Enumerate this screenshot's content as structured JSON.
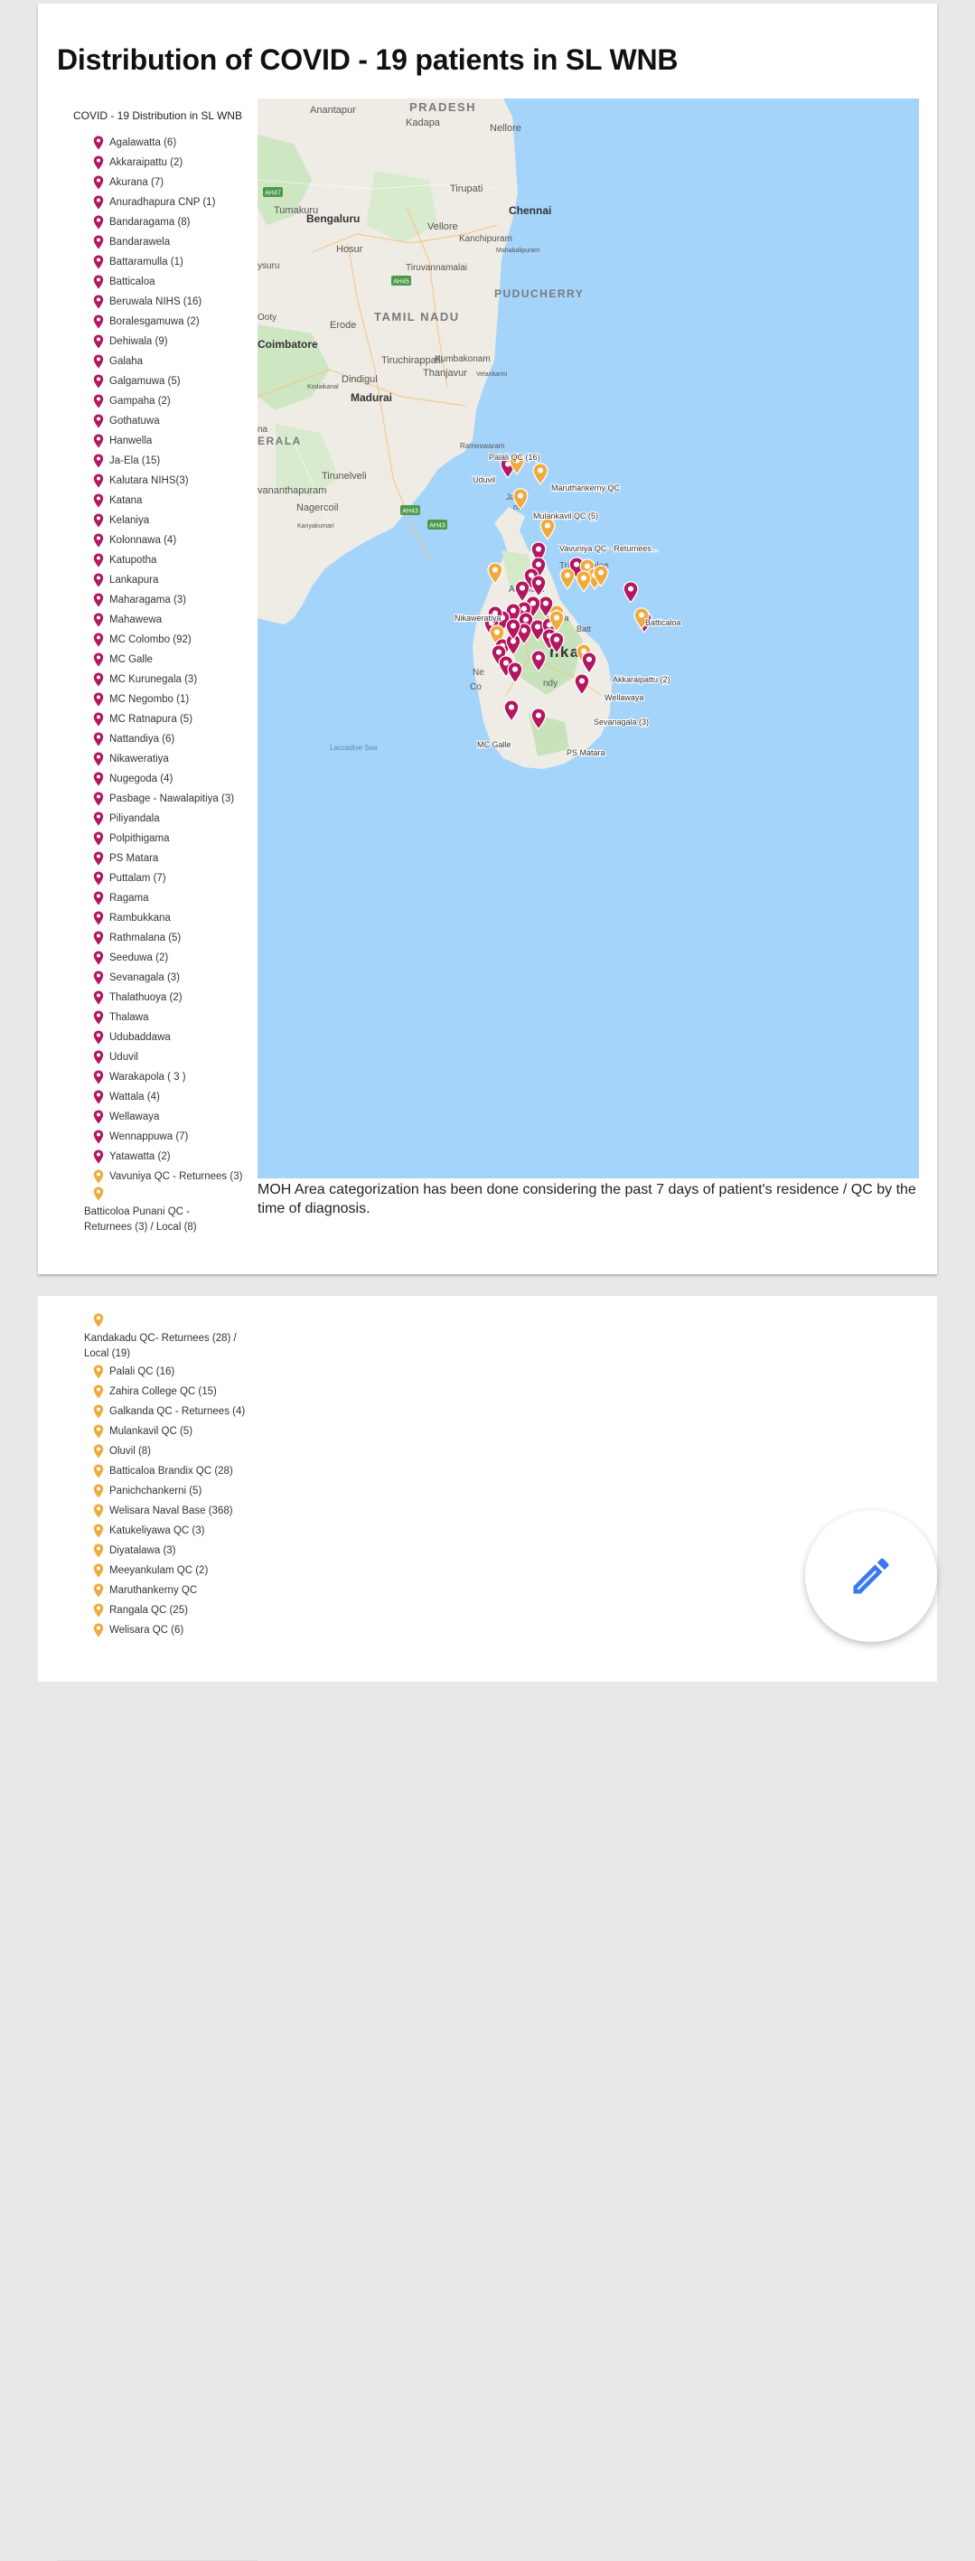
{
  "page": {
    "title": "Distribution of COVID - 19 patients in SL WNB",
    "caption": "MOH Area categorization has been done considering the past 7 days of patient's residence / QC by the time of diagnosis.",
    "colors": {
      "moh_pin": "#b3175f",
      "qc_pin": "#f2a93b",
      "sea": "#a5d4fb",
      "land": "#f1efe8",
      "edit_icon": "#3a78f2"
    }
  },
  "legend": {
    "title": "COVID - 19 Distribution in SL WNB",
    "moh_items": [
      "Agalawatta (6)",
      "Akkaraipattu (2)",
      "Akurana (7)",
      "Anuradhapura CNP (1)",
      "Bandaragama (8)",
      "Bandarawela",
      "Battaramulla (1)",
      "Batticaloa",
      "Beruwala NIHS (16)",
      "Boralesgamuwa (2)",
      "Dehiwala (9)",
      "Galaha",
      "Galgamuwa (5)",
      "Gampaha (2)",
      "Gothatuwa",
      "Hanwella",
      "Ja-Ela (15)",
      "Kalutara NIHS(3)",
      "Katana",
      "Kelaniya",
      "Kolonnawa (4)",
      "Katupotha",
      "Lankapura",
      "Maharagama (3)",
      "Mahawewa",
      "MC Colombo (92)",
      "MC Galle",
      "MC Kurunegala (3)",
      "MC Negombo (1)",
      "MC Ratnapura (5)",
      "Nattandiya (6)",
      "Nikaweratiya",
      "Nugegoda (4)",
      "Pasbage - Nawalapitiya (3)",
      "Piliyandala",
      "Polpithigama",
      "PS Matara",
      "Puttalam (7)",
      "Ragama",
      "Rambukkana",
      "Rathmalana (5)",
      "Seeduwa (2)",
      "Sevanagala (3)",
      "Thalathuoya (2)",
      "Thalawa",
      "Udubaddawa",
      "Uduvil",
      "Warakapola ( 3 )",
      "Wattala (4)",
      "Wellawaya",
      "Wennappuwa (7)",
      "Yatawatta (2)"
    ],
    "qc_items_card1": [
      "Vavuniya QC - Returnees (3)"
    ],
    "qc_wrap_card1": "Batticoloa Punani QC - Returnees (3) / Local (8)",
    "qc_wrap_card2": "Kandakadu QC- Returnees (28) / Local (19)",
    "qc_items_card2": [
      "Palali QC (16)",
      "Zahira College QC (15)",
      "Galkanda QC - Returnees (4)",
      "Mulankavil QC (5)",
      "Oluvil (8)",
      "Batticaloa Brandix QC (28)",
      "Panichchankerni (5)",
      "Welisara Naval Base (368)",
      "Katukeliyawa QC (3)",
      "Diyatalawa (3)",
      "Meeyankulam QC (2)",
      "Maruthankerny QC",
      "Rangala QC (25)",
      "Welisara QC (6)"
    ]
  },
  "map": {
    "place_labels": [
      "Anantapur",
      "PRADESH",
      "Kadapa",
      "Nellore",
      "Tirupati",
      "Tumakuru",
      "Bengaluru",
      "Vellore",
      "Chennai",
      "Hosur",
      "Kanchipuram",
      "Mahabalipuram",
      "ysuru",
      "Tiruvannamalai",
      "PUDUCHERRY",
      "Ooty",
      "Erode",
      "TAMIL NADU",
      "Coimbatore",
      "Kumbakonam",
      "Tiruchirappalli",
      "Thanjavur",
      "Velankanni",
      "Kodaikanal",
      "Dindigul",
      "Madurai",
      "na",
      "ERALA",
      "Rameswaram",
      "Tirunelveli",
      "vananthapuram",
      "Nagercoil",
      "Kanyakumari",
      "Laccadive Sea",
      "Trincomalee",
      "nka",
      "Ne",
      "Co",
      "ndy",
      "Anur",
      "pura",
      "mbula",
      "Batt",
      "Jaf",
      "na"
    ],
    "road_badges": [
      "AH47",
      "AH45",
      "AH43",
      "AH43"
    ],
    "pin_labels": [
      "Palali QC (16)",
      "Uduvil",
      "Maruthankerny QC",
      "Mulankavil QC (5)",
      "Vavuniya QC - Returnees...",
      "Nikaweratiya",
      "Batticaloa",
      "Akkaraipattu (2)",
      "Wellawaya",
      "Sevanagala (3)",
      "MC Galle",
      "PS Matara"
    ]
  },
  "fab": {
    "icon": "pencil-icon"
  }
}
